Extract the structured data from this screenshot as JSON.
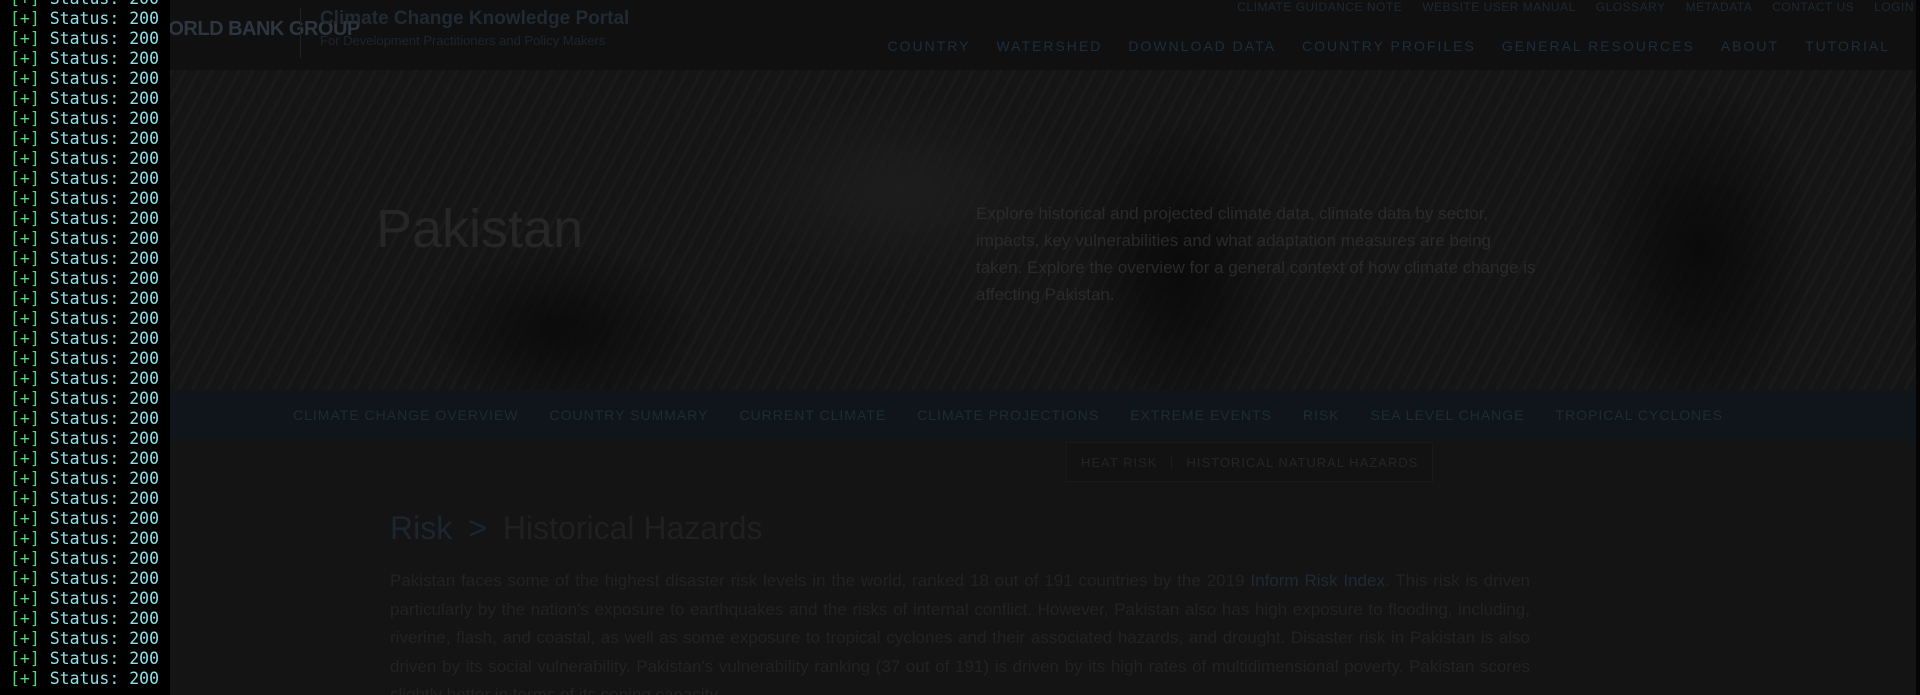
{
  "site": {
    "logo": "WORLD BANK GROUP",
    "title": "Climate Change Knowledge Portal",
    "subtitle": "For Development Practitioners and Policy Makers",
    "utility_nav": [
      "Climate Guidance Note",
      "Website User Manual",
      "Glossary",
      "Metadata",
      "Contact Us",
      "Login"
    ],
    "main_nav": [
      "Country",
      "Watershed",
      "Download Data",
      "Country Profiles",
      "General Resources",
      "About",
      "Tutorial"
    ]
  },
  "hero": {
    "country": "Pakistan",
    "description": "Explore historical and projected climate data, climate data by sector, impacts, key vulnerabilities and what adaptation measures are being taken. Explore the overview for a general context of how climate change is affecting Pakistan."
  },
  "section_tabs": [
    "Climate Change Overview",
    "Country Summary",
    "Current Climate",
    "Climate Projections",
    "Extreme Events",
    "Risk",
    "Sea Level Change",
    "Tropical Cyclones"
  ],
  "subtabs": [
    "Heat Risk",
    "Historical Natural Hazards"
  ],
  "breadcrumb": {
    "parent": "Risk",
    "separator": ">",
    "current": "Historical Hazards"
  },
  "intro": {
    "part1": "Pakistan faces some of the highest disaster risk levels in the world, ranked 18 out of 191 countries by the 2019 ",
    "link": "Inform Risk Index",
    "part2": ". This risk is driven particularly by the nation's exposure to earthquakes and the risks of internal conflict. However, Pakistan also has high exposure to flooding, including, riverine, flash, and coastal, as well as some exposure to tropical cyclones and their associated hazards, and drought. Disaster risk in Pakistan is also driven by its social vulnerability. Pakistan's vulnerability ranking (37 out of 191) is driven by its high rates of multidimensional poverty. Pakistan scores slightly better in terms of its coping capacity."
  },
  "terminal": {
    "line_prefix": "[+]",
    "line_text": " Status: 200",
    "line_count": 35
  },
  "colors": {
    "terminal_bg": "#000000",
    "prompt_green": "#4fd873",
    "text_cyan": "#8fe0e8"
  }
}
